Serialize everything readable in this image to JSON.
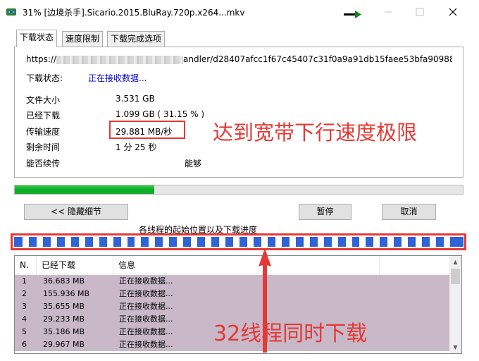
{
  "window": {
    "title": "31% [边境杀手].Sicario.2015.BluRay.720p.x264...mkv",
    "icon": "download-manager-icon",
    "controls": [
      "minimize-icon",
      "maximize-icon",
      "close-icon"
    ]
  },
  "tabs": [
    {
      "label": "下载状态",
      "active": true
    },
    {
      "label": "速度限制",
      "active": false
    },
    {
      "label": "下载完成选项",
      "active": false
    }
  ],
  "status_panel": {
    "url_prefix": "https://",
    "url_suffix": "andler/d28407afcc1f67c45407c31f0a9a91db15faee53bfa90988",
    "status_label": "下载状态:",
    "status_value": "正在接收数据...",
    "size_label": "文件大小",
    "size_value": "3.531  GB",
    "downloaded_label": "已经下载",
    "downloaded_value": "1.099  GB  ( 31.15 % )",
    "speed_label": "传输速度",
    "speed_value": "29.881  MB/秒",
    "remaining_label": "剩余时间",
    "remaining_value": "1 分 25 秒",
    "resume_label": "能否续传",
    "resume_value": "能够"
  },
  "progress": {
    "percent": 31.15,
    "color": "#06b025"
  },
  "buttons": {
    "hide_details": "<< 隐藏细节",
    "pause": "暂停",
    "cancel": "取消"
  },
  "threads_caption": "各线程的起始位置以及下载进度",
  "thread_list": {
    "headers": [
      "N.",
      "已经下载",
      "信息"
    ],
    "rows": [
      {
        "no": "1",
        "downloaded": "36.683  MB",
        "info": "正在接收数据..."
      },
      {
        "no": "2",
        "downloaded": "155.936  MB",
        "info": "正在接收数据..."
      },
      {
        "no": "3",
        "downloaded": "35.655  MB",
        "info": "正在接收数据..."
      },
      {
        "no": "4",
        "downloaded": "29.233  MB",
        "info": "正在接收数据..."
      },
      {
        "no": "5",
        "downloaded": "35.186  MB",
        "info": "正在接收数据..."
      },
      {
        "no": "6",
        "downloaded": "29.967  MB",
        "info": "正在接收数据..."
      }
    ]
  },
  "annotations": {
    "speed_note": "达到宽带下行速度极限",
    "threads_note": "32线程同时下载",
    "color": "#e53935"
  }
}
